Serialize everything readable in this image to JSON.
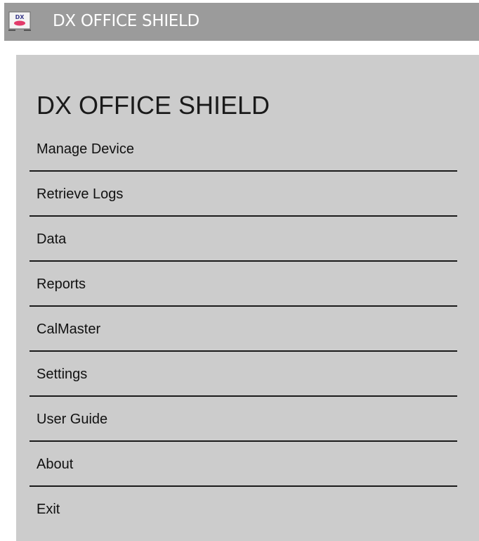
{
  "window": {
    "title": "DX OFFICE SHIELD",
    "icon": "dx-app-icon",
    "icon_text": "DX"
  },
  "panel": {
    "title": "DX OFFICE SHIELD"
  },
  "menu": {
    "items": [
      {
        "label": "Manage Device"
      },
      {
        "label": "Retrieve Logs"
      },
      {
        "label": "Data"
      },
      {
        "label": "Reports"
      },
      {
        "label": "CalMaster"
      },
      {
        "label": "Settings"
      },
      {
        "label": "User Guide"
      },
      {
        "label": "About"
      },
      {
        "label": "Exit"
      }
    ]
  },
  "colors": {
    "titlebar": "#9b9b9b",
    "panel": "#cccccc",
    "separator": "#1a1a1a",
    "title_text": "#ffffff"
  }
}
